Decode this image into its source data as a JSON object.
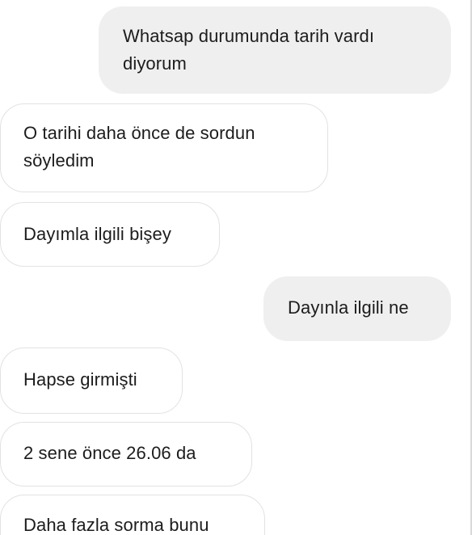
{
  "conversation": {
    "messages": [
      {
        "side": "sent",
        "lines": [
          "Whatsap durumunda tarih vardı",
          "diyorum"
        ]
      },
      {
        "side": "received",
        "lines": [
          "O tarihi daha önce de sordun",
          "söyledim"
        ]
      },
      {
        "side": "received",
        "lines": [
          "Dayımla ilgili bişey"
        ]
      },
      {
        "side": "sent",
        "lines": [
          "Dayınla ilgili ne"
        ]
      },
      {
        "side": "received",
        "lines": [
          "Hapse girmişti"
        ]
      },
      {
        "side": "received",
        "lines": [
          "2 sene önce 26.06 da"
        ]
      },
      {
        "side": "received",
        "lines": [
          "Daha fazla sorma bunu"
        ]
      }
    ]
  },
  "colors": {
    "sent_bubble": "#efefef",
    "received_bubble": "#ffffff",
    "received_border": "#e2e2e2",
    "text": "#1c1c1c"
  }
}
